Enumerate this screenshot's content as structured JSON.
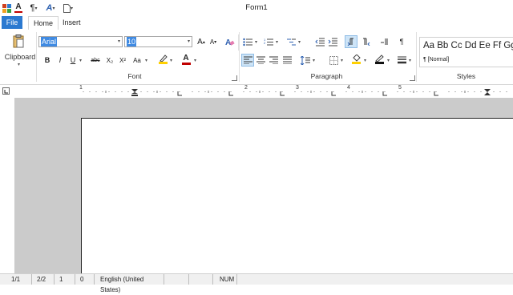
{
  "window": {
    "title": "Form1"
  },
  "quick_access": [
    {
      "icon": "app-icon"
    },
    {
      "icon": "font-color-icon",
      "glyph": "A"
    },
    {
      "icon": "paragraph-mark-icon",
      "glyph": "¶"
    },
    {
      "icon": "text-highlight-icon",
      "glyph": "A"
    },
    {
      "icon": "new-document-icon"
    }
  ],
  "tabs": {
    "file": "File",
    "home": "Home",
    "insert": "Insert"
  },
  "clipboard": {
    "label": "Clipboard"
  },
  "font": {
    "name": "Arial",
    "size": "10",
    "group_label": "Font",
    "buttons": {
      "bold": "B",
      "italic": "I",
      "underline": "U",
      "strike": "abc",
      "subscript": "X₂",
      "superscript": "X²",
      "change_case": "Aa",
      "grow": "A",
      "shrink": "A"
    }
  },
  "paragraph": {
    "group_label": "Paragraph",
    "show_marks": "¶"
  },
  "styles": {
    "preview": "Aa Bb Cc Dd Ee Ff Gg",
    "normal": "¶ [Normal]",
    "group_label": "Styles"
  },
  "ruler": {
    "numbers": [
      "1",
      "2",
      "3",
      "4",
      "5"
    ]
  },
  "statusbar": {
    "page": "1/1",
    "section": "2/2",
    "line": "1",
    "column": "0",
    "language": "English (United States)",
    "num": "NUM"
  },
  "colors": {
    "file_tab": "#2b79d0",
    "selection": "#3f8ae2",
    "workspace": "#cbcbcb",
    "font_color_bar": "#c00000",
    "highlight_bar": "#ffd000"
  }
}
